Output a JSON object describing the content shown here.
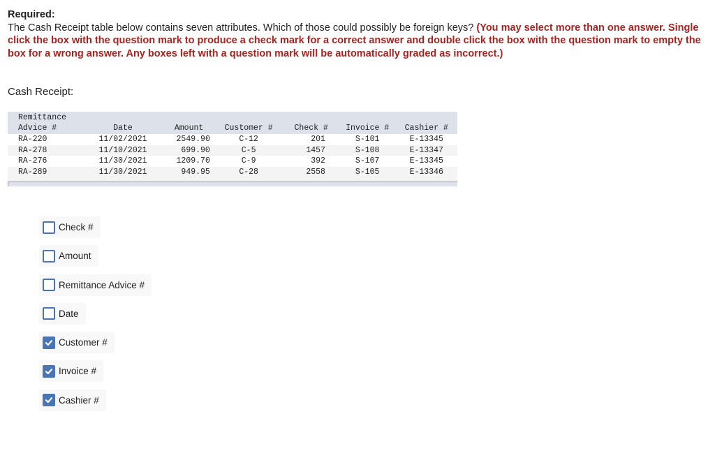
{
  "question": {
    "heading": "Required:",
    "text": "The Cash Receipt table below contains seven attributes. Which of those could possibly be foreign keys? ",
    "instructions": "(You may select more than one answer. Single click the box with the question mark to produce a check mark for a correct answer and double click the box with the question mark to empty the box for a wrong answer. Any boxes left with a question mark will be automatically graded as incorrect.)"
  },
  "table_label": "Cash Receipt:",
  "table": {
    "headers": [
      "Remittance\nAdvice #",
      "Date",
      "Amount",
      "Customer #",
      "Check #",
      "Invoice #",
      "Cashier #"
    ],
    "rows": [
      [
        "RA-220",
        "11/02/2021",
        "2549.90",
        "C-12",
        "201",
        "S-101",
        "E-13345"
      ],
      [
        "RA-278",
        "11/10/2021",
        "699.90",
        "C-5",
        "1457",
        "S-108",
        "E-13347"
      ],
      [
        "RA-276",
        "11/30/2021",
        "1209.70",
        "C-9",
        "392",
        "S-107",
        "E-13345"
      ],
      [
        "RA-289",
        "11/30/2021",
        "949.95",
        "C-28",
        "2558",
        "S-105",
        "E-13346"
      ]
    ]
  },
  "options": [
    {
      "label": "Check #",
      "checked": false
    },
    {
      "label": "Amount",
      "checked": false
    },
    {
      "label": "Remittance Advice #",
      "checked": false
    },
    {
      "label": "Date",
      "checked": false
    },
    {
      "label": "Customer #",
      "checked": true
    },
    {
      "label": "Invoice #",
      "checked": true
    },
    {
      "label": "Cashier #",
      "checked": true
    }
  ],
  "colors": {
    "instruction_red": "#a8231f",
    "checkbox_blue": "#4a75b5",
    "table_header_bg": "#dce1ea"
  }
}
